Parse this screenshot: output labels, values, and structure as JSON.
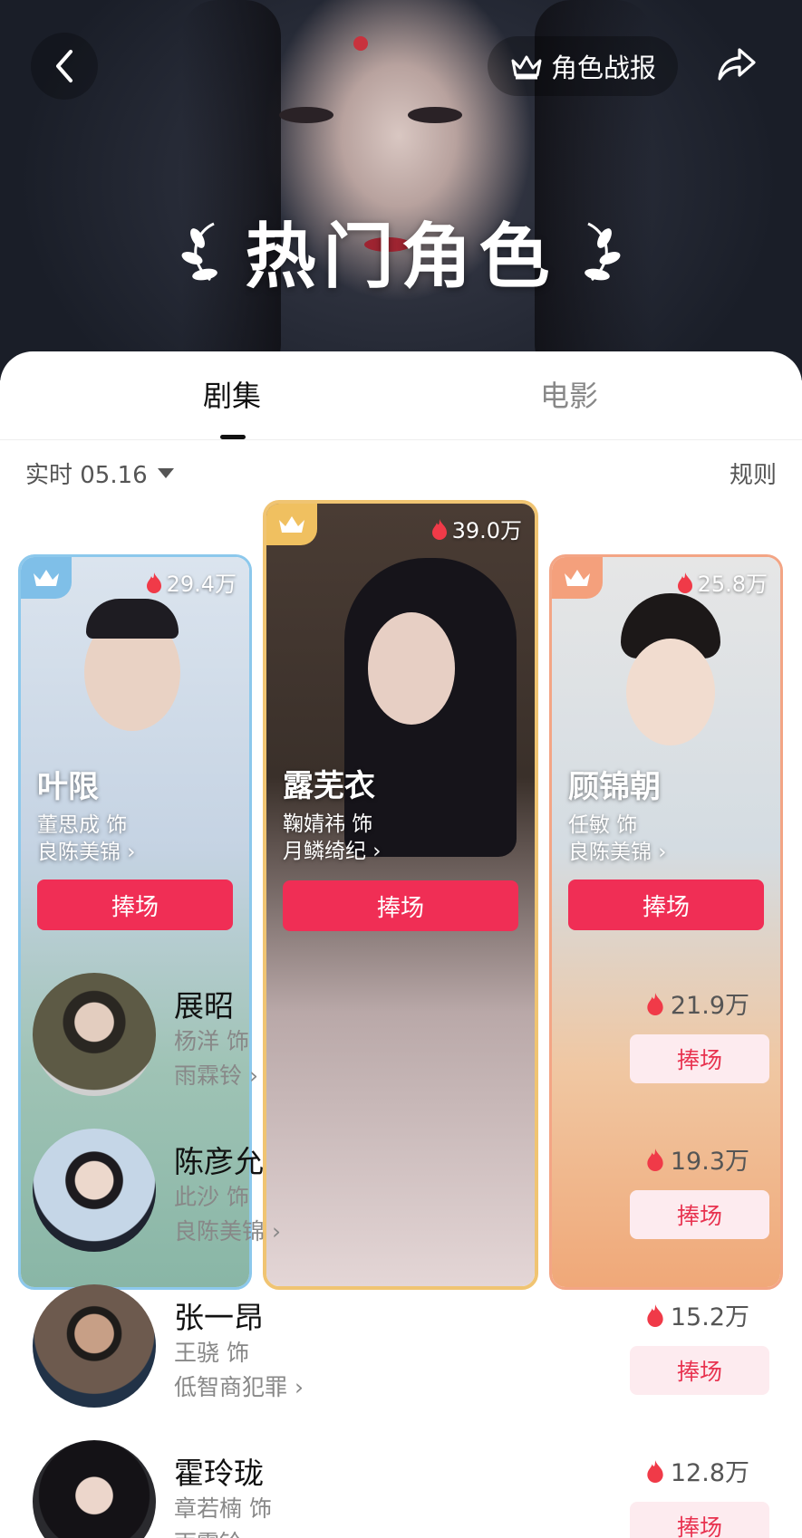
{
  "header": {
    "report_label": "角色战报",
    "title": "热门角色"
  },
  "tabs": [
    {
      "label": "剧集",
      "active": true
    },
    {
      "label": "电影",
      "active": false
    }
  ],
  "filter": {
    "label": "实时 05.16",
    "rules_label": "规则"
  },
  "top_cards": [
    {
      "rank": 2,
      "heat": "29.4万",
      "name": "叶限",
      "actor": "董思成 饰",
      "drama": "良陈美锦",
      "button": "捧场",
      "accent": "#7fbfe8"
    },
    {
      "rank": 1,
      "heat": "39.0万",
      "name": "露芜衣",
      "actor": "鞠婧祎 饰",
      "drama": "月鳞绮纪",
      "button": "捧场",
      "accent": "#f0c060"
    },
    {
      "rank": 3,
      "heat": "25.8万",
      "name": "顾锦朝",
      "actor": "任敏 饰",
      "drama": "良陈美锦",
      "button": "捧场",
      "accent": "#f4a07c"
    }
  ],
  "list": [
    {
      "name": "展昭",
      "actor": "杨洋 饰",
      "drama": "雨霖铃",
      "heat": "21.9万",
      "button": "捧场"
    },
    {
      "name": "陈彦允",
      "actor": "此沙 饰",
      "drama": "良陈美锦",
      "heat": "19.3万",
      "button": "捧场"
    },
    {
      "name": "张一昂",
      "actor": "王骁 饰",
      "drama": "低智商犯罪",
      "heat": "15.2万",
      "button": "捧场"
    },
    {
      "name": "霍玲珑",
      "actor": "章若楠 饰",
      "drama": "雨霖铃",
      "heat": "12.8万",
      "button": "捧场"
    }
  ],
  "colors": {
    "primary_red": "#f02e55",
    "soft_red_bg": "#fdebef",
    "flame": "#f03a48"
  }
}
